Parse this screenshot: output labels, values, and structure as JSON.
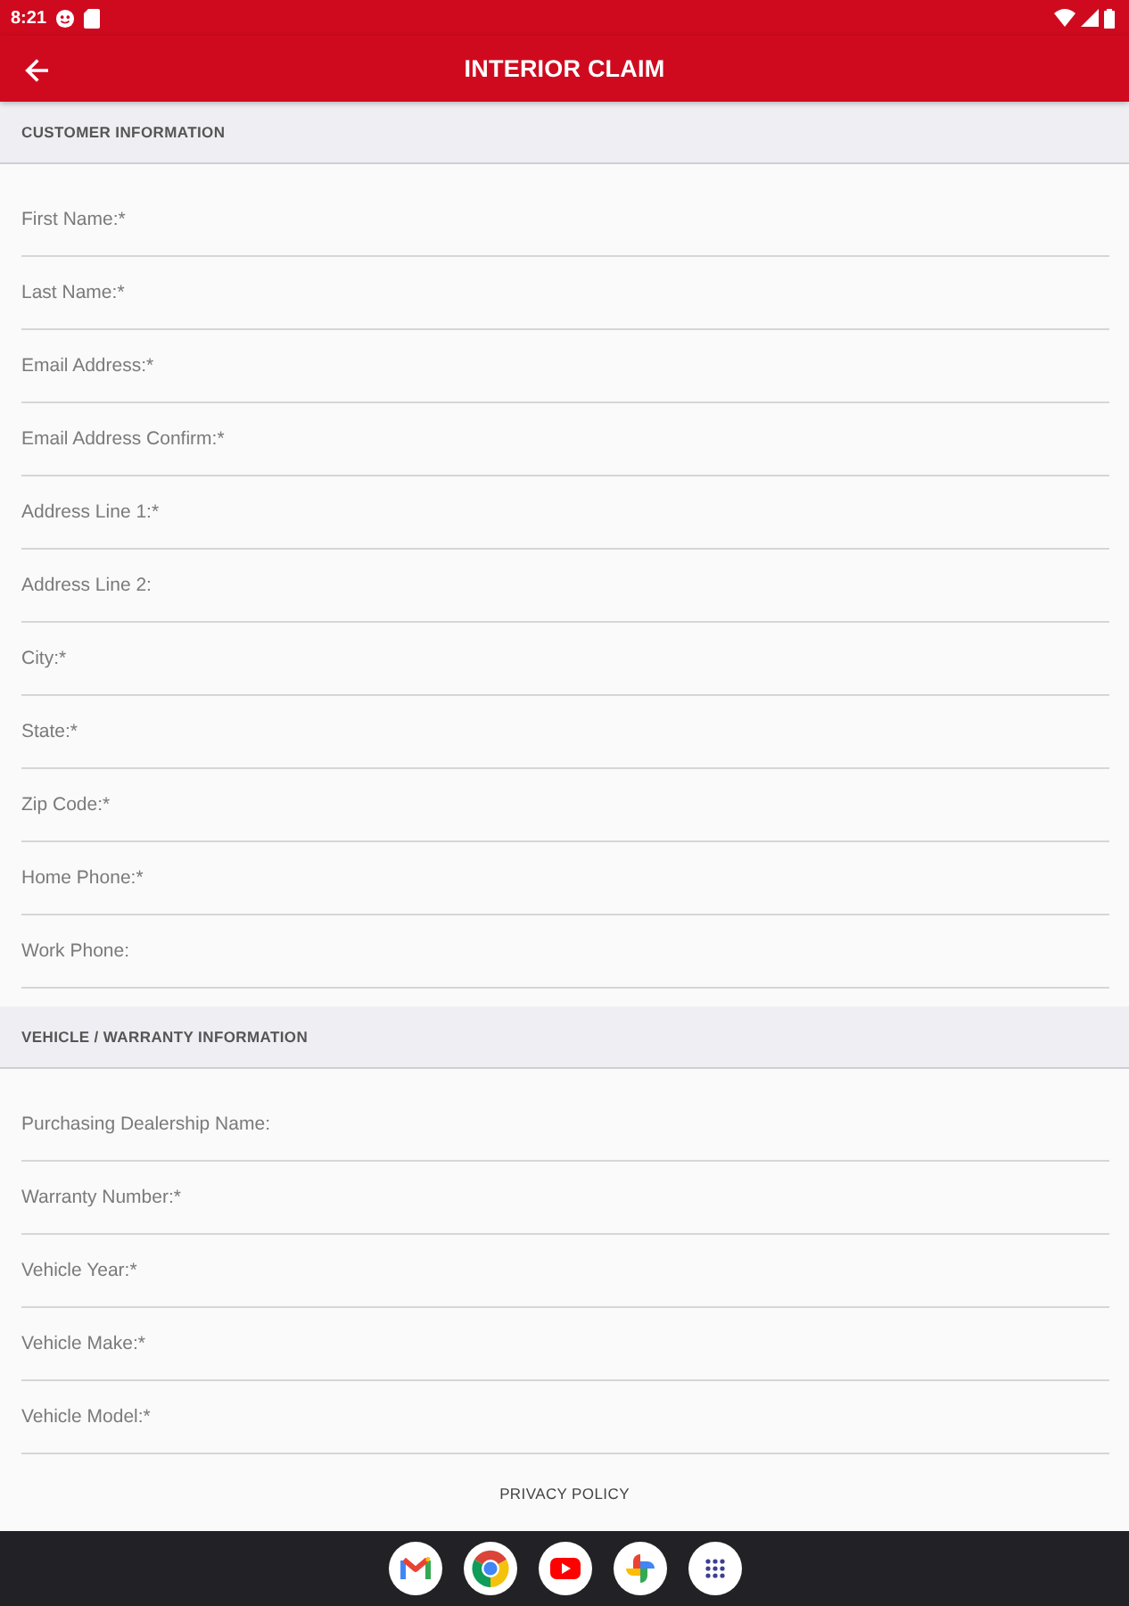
{
  "status_bar": {
    "time": "8:21"
  },
  "app_bar": {
    "title": "INTERIOR CLAIM"
  },
  "sections": [
    {
      "title": "CUSTOMER INFORMATION",
      "fields": [
        {
          "placeholder": "First Name:*"
        },
        {
          "placeholder": "Last Name:*"
        },
        {
          "placeholder": "Email Address:*"
        },
        {
          "placeholder": "Email Address Confirm:*"
        },
        {
          "placeholder": "Address Line 1:*"
        },
        {
          "placeholder": "Address Line 2:"
        },
        {
          "placeholder": "City:*"
        },
        {
          "placeholder": "State:*"
        },
        {
          "placeholder": "Zip Code:*"
        },
        {
          "placeholder": "Home Phone:*"
        },
        {
          "placeholder": "Work Phone:"
        }
      ]
    },
    {
      "title": "VEHICLE / WARRANTY INFORMATION",
      "fields": [
        {
          "placeholder": "Purchasing Dealership Name:"
        },
        {
          "placeholder": "Warranty Number:*"
        },
        {
          "placeholder": "Vehicle Year:*"
        },
        {
          "placeholder": "Vehicle Make:*"
        },
        {
          "placeholder": "Vehicle Model:*"
        }
      ]
    }
  ],
  "footer": {
    "link": "PRIVACY POLICY"
  }
}
